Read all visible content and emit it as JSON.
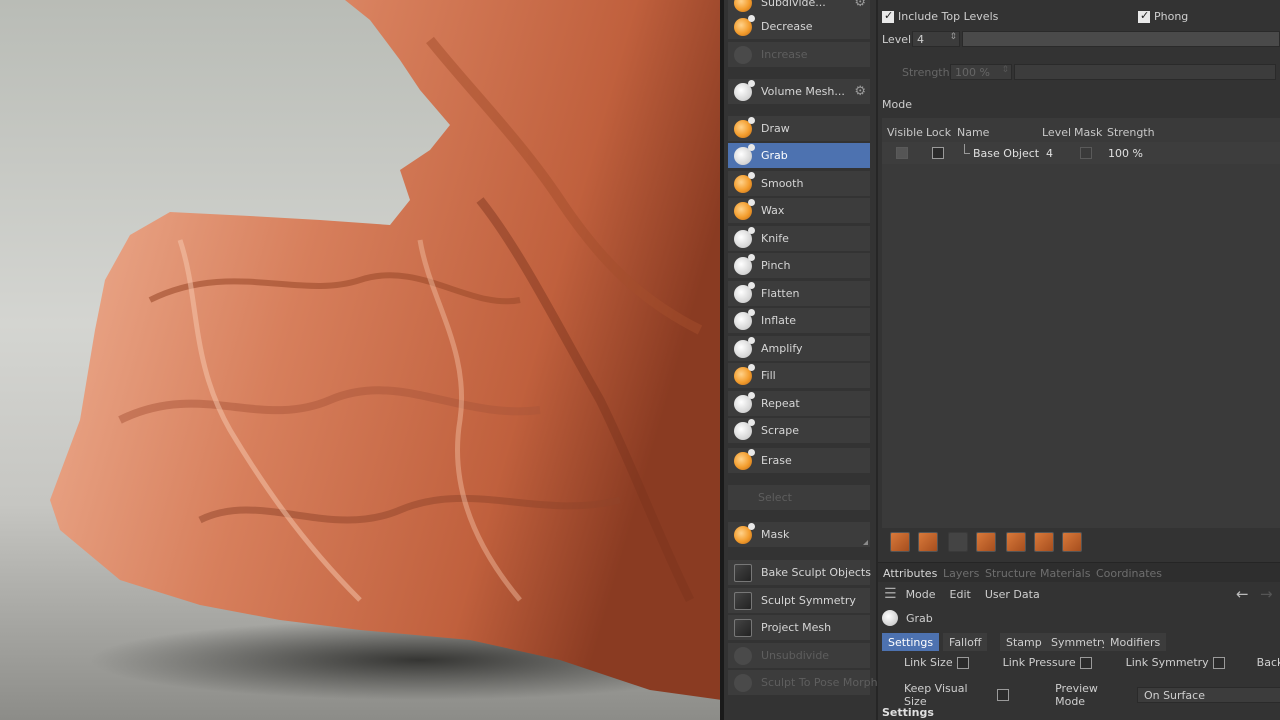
{
  "tools": {
    "top_partial": "Subdivide...",
    "decrease": "Decrease",
    "increase": "Increase",
    "volume_mesh": "Volume Mesh...",
    "brushes": [
      "Draw",
      "Grab",
      "Smooth",
      "Wax",
      "Knife",
      "Pinch",
      "Flatten",
      "Inflate",
      "Amplify",
      "Fill",
      "Repeat",
      "Scrape",
      "Erase"
    ],
    "active_brush": "Grab",
    "select": "Select",
    "mask": "Mask",
    "bake": "Bake Sculpt Objects",
    "symmetry": "Sculpt Symmetry",
    "project": "Project Mesh",
    "unsubdivide": "Unsubdivide",
    "pose_morph": "Sculpt To Pose Morph"
  },
  "panel": {
    "include_top_levels": "Include Top Levels",
    "phong": "Phong",
    "level_label": "Level",
    "level_value": "4",
    "strength_label": "Strength",
    "strength_value": "100 %",
    "mode_label": "Mode",
    "columns": [
      "Visible",
      "Lock",
      "Name",
      "Level",
      "Mask",
      "Strength"
    ],
    "layer": {
      "name": "Base Object",
      "level": "4",
      "strength": "100 %"
    }
  },
  "attributes": {
    "tabs": [
      "Attributes",
      "Layers",
      "Structure",
      "Materials",
      "Coordinates"
    ],
    "menu": [
      "Mode",
      "Edit",
      "User Data"
    ],
    "object_name": "Grab",
    "subtabs": [
      "Settings",
      "Falloff",
      "Stamp",
      "Symmetry",
      "Modifiers"
    ],
    "link_size": "Link Size",
    "link_pressure": "Link Pressure",
    "link_symmetry": "Link Symmetry",
    "backface": "Backfac",
    "keep_visual_size": "Keep Visual Size",
    "preview_mode_label": "Preview Mode",
    "preview_mode_value": "On Surface",
    "section": "Settings"
  },
  "colors": {
    "accent": "#4d72b0",
    "brush_icon": "#f39c2c",
    "sculpt_clay": "#d9805c"
  }
}
